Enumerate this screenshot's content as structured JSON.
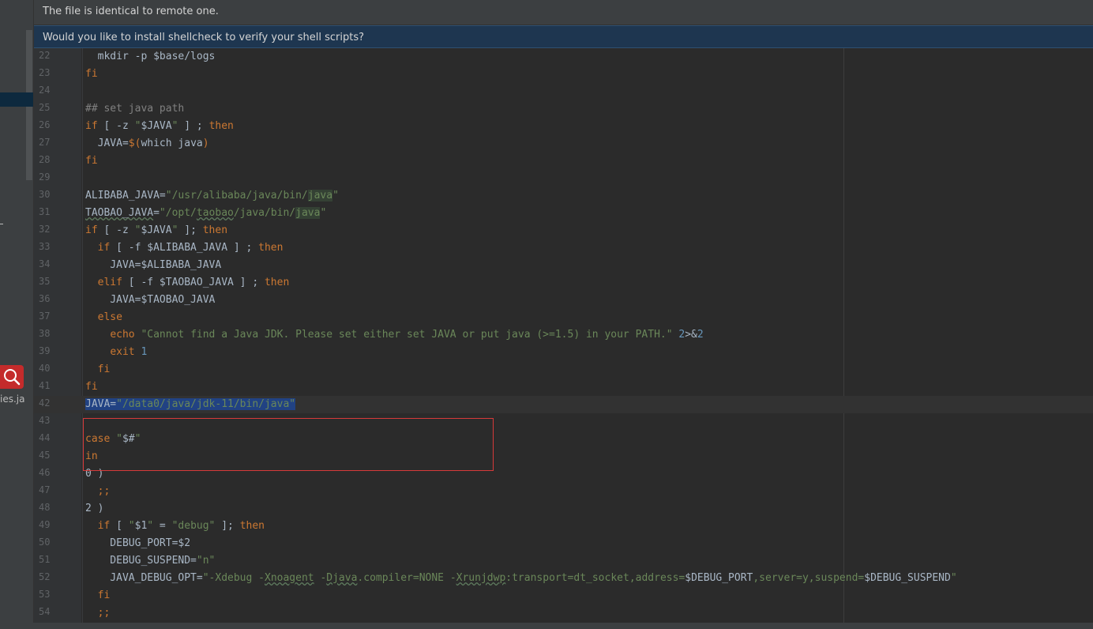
{
  "notifications": {
    "identical": "The file is identical to remote one.",
    "shellcheck": "Would you like to install shellcheck to verify your shell scripts?"
  },
  "sidebar": {
    "file_fragment": "ies.ja",
    "search_icon": "search-icon",
    "dash": "-"
  },
  "editor": {
    "lines": [
      {
        "n": "22",
        "tokens": [
          {
            "t": "  mkdir -p $base/logs"
          }
        ]
      },
      {
        "n": "23",
        "tokens": [
          {
            "t": "fi",
            "c": "k"
          }
        ]
      },
      {
        "n": "24",
        "tokens": []
      },
      {
        "n": "25",
        "tokens": [
          {
            "t": "## set java path",
            "c": "c"
          }
        ]
      },
      {
        "n": "26",
        "tokens": [
          {
            "t": "if",
            "c": "k"
          },
          {
            "t": " [ -z "
          },
          {
            "t": "\"",
            "c": "s"
          },
          {
            "t": "$JAVA"
          },
          {
            "t": "\"",
            "c": "s"
          },
          {
            "t": " ] ; "
          },
          {
            "t": "then",
            "c": "k"
          }
        ]
      },
      {
        "n": "27",
        "tokens": [
          {
            "t": "  JAVA="
          },
          {
            "t": "$(",
            "c": "k"
          },
          {
            "t": "which java"
          },
          {
            "t": ")",
            "c": "k"
          }
        ]
      },
      {
        "n": "28",
        "tokens": [
          {
            "t": "fi",
            "c": "k"
          }
        ]
      },
      {
        "n": "29",
        "tokens": []
      },
      {
        "n": "30",
        "tokens": [
          {
            "t": "ALIBABA_JAVA="
          },
          {
            "t": "\"/usr/alibaba/java/bin/",
            "c": "s"
          },
          {
            "t": "java",
            "c": "s hl"
          },
          {
            "t": "\"",
            "c": "s"
          }
        ]
      },
      {
        "n": "31",
        "tokens": [
          {
            "t": "TAOBAO_JAVA",
            "c": "wavy"
          },
          {
            "t": "="
          },
          {
            "t": "\"/opt/",
            "c": "s"
          },
          {
            "t": "taobao",
            "c": "s wavy"
          },
          {
            "t": "/java/bin/",
            "c": "s"
          },
          {
            "t": "java",
            "c": "s hl"
          },
          {
            "t": "\"",
            "c": "s"
          }
        ]
      },
      {
        "n": "32",
        "tokens": [
          {
            "t": "if",
            "c": "k"
          },
          {
            "t": " [ -z "
          },
          {
            "t": "\"",
            "c": "s"
          },
          {
            "t": "$JAVA"
          },
          {
            "t": "\"",
            "c": "s"
          },
          {
            "t": " ]; "
          },
          {
            "t": "then",
            "c": "k"
          }
        ]
      },
      {
        "n": "33",
        "tokens": [
          {
            "t": "  "
          },
          {
            "t": "if",
            "c": "k"
          },
          {
            "t": " [ -f $ALIBABA_JAVA ] ; "
          },
          {
            "t": "then",
            "c": "k"
          }
        ]
      },
      {
        "n": "34",
        "tokens": [
          {
            "t": "    JAVA=$ALIBABA_JAVA"
          }
        ]
      },
      {
        "n": "35",
        "tokens": [
          {
            "t": "  "
          },
          {
            "t": "elif",
            "c": "k"
          },
          {
            "t": " [ -f $TAOBAO_JAVA ] ; "
          },
          {
            "t": "then",
            "c": "k"
          }
        ]
      },
      {
        "n": "36",
        "tokens": [
          {
            "t": "    JAVA=$TAOBAO_JAVA"
          }
        ]
      },
      {
        "n": "37",
        "tokens": [
          {
            "t": "  "
          },
          {
            "t": "else",
            "c": "k"
          }
        ]
      },
      {
        "n": "38",
        "tokens": [
          {
            "t": "    "
          },
          {
            "t": "echo",
            "c": "k"
          },
          {
            "t": " "
          },
          {
            "t": "\"Cannot find a Java JDK. Please set either set JAVA or put java (>=1.5) in your PATH.\"",
            "c": "s"
          },
          {
            "t": " "
          },
          {
            "t": "2",
            "c": "n"
          },
          {
            "t": ">&"
          },
          {
            "t": "2",
            "c": "n"
          }
        ]
      },
      {
        "n": "39",
        "tokens": [
          {
            "t": "    "
          },
          {
            "t": "exit",
            "c": "k"
          },
          {
            "t": " "
          },
          {
            "t": "1",
            "c": "n"
          }
        ]
      },
      {
        "n": "40",
        "tokens": [
          {
            "t": "  "
          },
          {
            "t": "fi",
            "c": "k"
          }
        ]
      },
      {
        "n": "41",
        "tokens": [
          {
            "t": "fi",
            "c": "k"
          }
        ]
      },
      {
        "n": "42",
        "current": true,
        "tokens": [
          {
            "t": "JAVA=",
            "c": "sel"
          },
          {
            "t": "\"/data0/java/jdk-11/bin/java\"",
            "c": "s sel"
          }
        ]
      },
      {
        "n": "43",
        "tokens": []
      },
      {
        "n": "44",
        "tokens": [
          {
            "t": "case",
            "c": "k"
          },
          {
            "t": " "
          },
          {
            "t": "\"",
            "c": "s"
          },
          {
            "t": "$#"
          },
          {
            "t": "\"",
            "c": "s"
          }
        ]
      },
      {
        "n": "45",
        "tokens": [
          {
            "t": "in",
            "c": "k"
          }
        ]
      },
      {
        "n": "46",
        "tokens": [
          {
            "t": "0 )"
          }
        ]
      },
      {
        "n": "47",
        "tokens": [
          {
            "t": "  "
          },
          {
            "t": ";;",
            "c": "k"
          }
        ]
      },
      {
        "n": "48",
        "tokens": [
          {
            "t": "2 )"
          }
        ]
      },
      {
        "n": "49",
        "tokens": [
          {
            "t": "  "
          },
          {
            "t": "if",
            "c": "k"
          },
          {
            "t": " [ "
          },
          {
            "t": "\"",
            "c": "s"
          },
          {
            "t": "$1"
          },
          {
            "t": "\"",
            "c": "s"
          },
          {
            "t": " = "
          },
          {
            "t": "\"debug\"",
            "c": "s"
          },
          {
            "t": " ]; "
          },
          {
            "t": "then",
            "c": "k"
          }
        ]
      },
      {
        "n": "50",
        "tokens": [
          {
            "t": "    DEBUG_PORT=$2"
          }
        ]
      },
      {
        "n": "51",
        "tokens": [
          {
            "t": "    DEBUG_SUSPEND="
          },
          {
            "t": "\"n\"",
            "c": "s"
          }
        ]
      },
      {
        "n": "52",
        "tokens": [
          {
            "t": "    JAVA_DEBUG_OPT="
          },
          {
            "t": "\"-Xdebug -",
            "c": "s"
          },
          {
            "t": "Xnoagent",
            "c": "s wavy"
          },
          {
            "t": " -",
            "c": "s"
          },
          {
            "t": "Djava",
            "c": "s wavy"
          },
          {
            "t": ".compiler=NONE -",
            "c": "s"
          },
          {
            "t": "Xrunjdwp",
            "c": "s wavy"
          },
          {
            "t": ":transport=dt_socket,address=",
            "c": "s"
          },
          {
            "t": "$DEBUG_PORT"
          },
          {
            "t": ",server=y,suspend=",
            "c": "s"
          },
          {
            "t": "$DEBUG_SUSPEND"
          },
          {
            "t": "\"",
            "c": "s"
          }
        ]
      },
      {
        "n": "53",
        "tokens": [
          {
            "t": "  "
          },
          {
            "t": "fi",
            "c": "k"
          }
        ]
      },
      {
        "n": "54",
        "tokens": [
          {
            "t": "  "
          },
          {
            "t": ";;",
            "c": "k"
          }
        ]
      }
    ]
  }
}
